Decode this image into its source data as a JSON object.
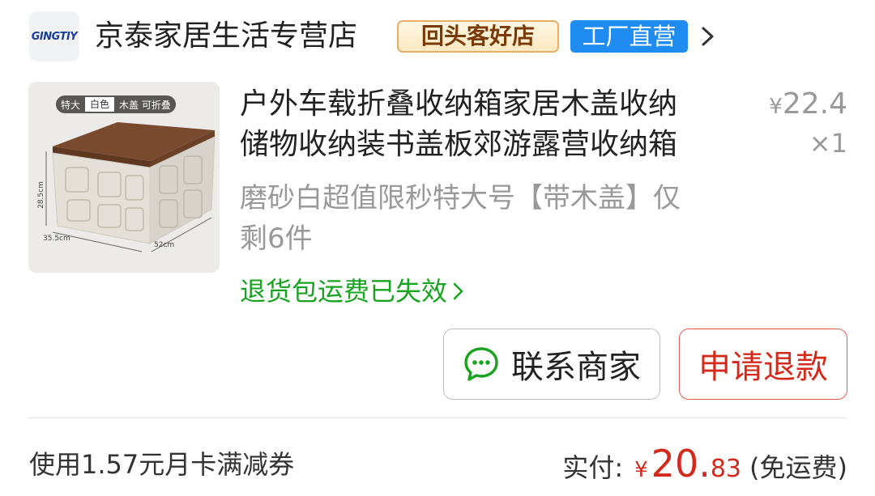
{
  "shop": {
    "logo_text": "GINGTIY",
    "name": "京泰家居生活专营店",
    "badge_repeat": "回头客好店",
    "badge_factory": "工厂直营"
  },
  "product": {
    "image_tag": [
      "特大",
      "白色",
      "木盖 可折叠"
    ],
    "image_dims": [
      "28.5cm",
      "35.5cm",
      "52cm"
    ],
    "title_line1": "户外车载折叠收纳箱家居木盖收纳",
    "title_line2": "储物收纳装书盖板郊游露营收纳箱",
    "spec_line1": "磨砂白超值限秒特大号【带木盖】仅",
    "spec_line2": "剩6件",
    "price_yen": "¥",
    "price_value": "22.4",
    "quantity": "×1"
  },
  "return_link": "退货包运费已失效",
  "buttons": {
    "contact": "联系商家",
    "refund": "申请退款"
  },
  "footer": {
    "coupon_text": "使用1.57元月卡满减券",
    "paid_label": "实付:",
    "paid_yen": "¥",
    "paid_int": "20.",
    "paid_dec": "83",
    "shipping_note": "(免运费)"
  },
  "colors": {
    "green": "#1aa321",
    "red": "#d42a1c",
    "blue_badge": "#1e8cf0",
    "gold_badge": "#e6b06a"
  }
}
